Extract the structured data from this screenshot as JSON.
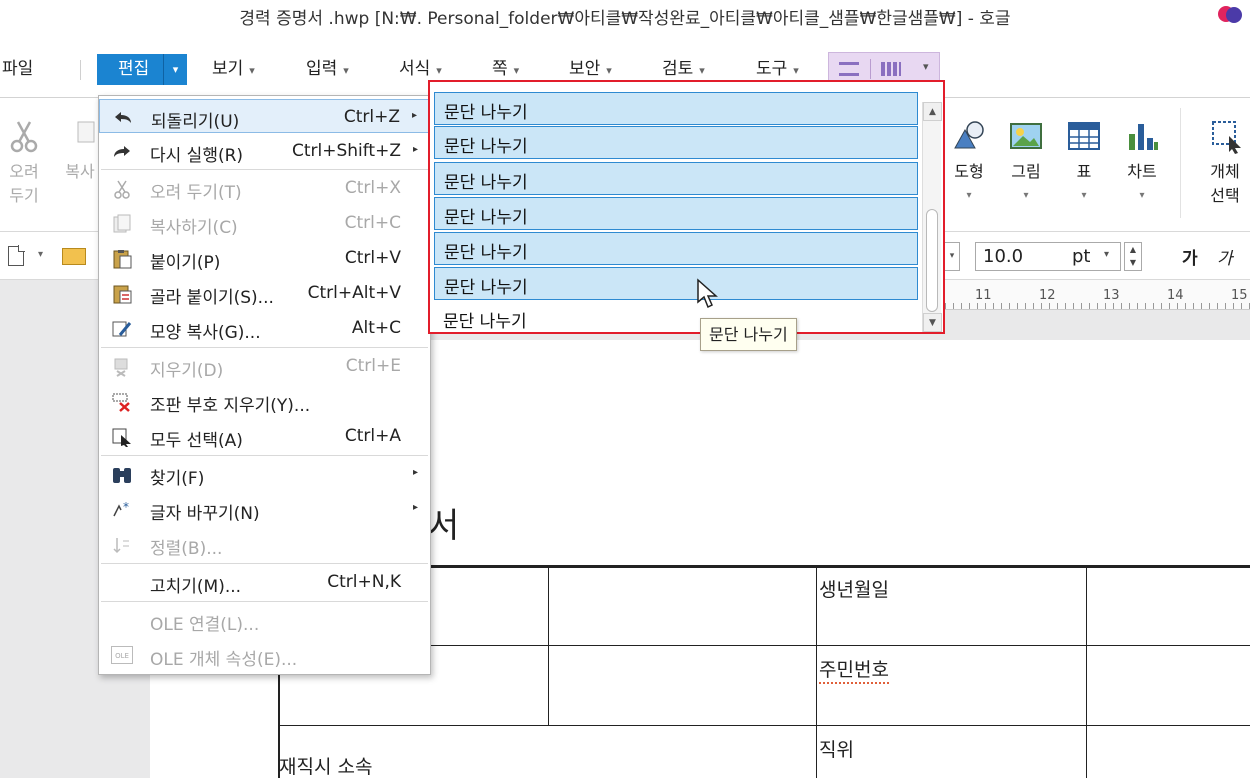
{
  "window": {
    "title": "경력 증명서 .hwp [N:₩. Personal_folder₩아티클₩작성완료_아티클₩아티클_샘플₩한글샘플₩] - 호글"
  },
  "menubar": {
    "file": "파일",
    "edit": "편집",
    "items": [
      {
        "label": "보기",
        "caret": "▾"
      },
      {
        "label": "입력",
        "caret": "▾"
      },
      {
        "label": "서식",
        "caret": "▾"
      },
      {
        "label": "쪽",
        "caret": "▾"
      },
      {
        "label": "보안",
        "caret": "▾"
      },
      {
        "label": "검토",
        "caret": "▾"
      },
      {
        "label": "도구",
        "caret": "▾"
      }
    ],
    "caret_glyph": "▾"
  },
  "ribbon": {
    "cut": {
      "label1": "오려",
      "label2": "두기"
    },
    "copy": {
      "label": "복사"
    },
    "shape": {
      "label": "도형"
    },
    "picture": {
      "label": "그림"
    },
    "table": {
      "label": "표"
    },
    "chart": {
      "label": "차트"
    },
    "object": {
      "label1": "개체",
      "label2": "선택"
    }
  },
  "toolbar2": {
    "font_size": "10.0",
    "unit": "pt",
    "bold": "가",
    "italic": "가"
  },
  "ruler": {
    "ticks": [
      "11",
      "12",
      "13",
      "14",
      "15"
    ]
  },
  "edit_menu": {
    "items": [
      {
        "label": "되돌리기(U)",
        "shortcut": "Ctrl+Z",
        "icon": "undo-icon"
      },
      {
        "label": "다시 실행(R)",
        "shortcut": "Ctrl+Shift+Z",
        "icon": "redo-icon"
      },
      {
        "label": "오려 두기(T)",
        "shortcut": "Ctrl+X",
        "icon": "cut-icon"
      },
      {
        "label": "복사하기(C)",
        "shortcut": "Ctrl+C",
        "icon": "copy-icon"
      },
      {
        "label": "붙이기(P)",
        "shortcut": "Ctrl+V",
        "icon": "paste-icon"
      },
      {
        "label": "골라 붙이기(S)...",
        "shortcut": "Ctrl+Alt+V",
        "icon": "paste-special-icon"
      },
      {
        "label": "모양 복사(G)...",
        "shortcut": "Alt+C",
        "icon": "format-painter-icon"
      },
      {
        "label": "지우기(D)",
        "shortcut": "Ctrl+E",
        "icon": "erase-icon"
      },
      {
        "label": "조판 부호 지우기(Y)...",
        "shortcut": "",
        "icon": "erase-codes-icon"
      },
      {
        "label": "모두 선택(A)",
        "shortcut": "Ctrl+A",
        "icon": "select-all-icon"
      },
      {
        "label": "찾기(F)",
        "shortcut": "",
        "icon": "binoculars-icon"
      },
      {
        "label": "글자 바꾸기(N)",
        "shortcut": "",
        "icon": "char-change-icon"
      },
      {
        "label": "정렬(B)...",
        "shortcut": "",
        "icon": "sort-icon"
      },
      {
        "label": "고치기(M)...",
        "shortcut": "Ctrl+N,K",
        "icon": ""
      },
      {
        "label": "OLE 연결(L)...",
        "shortcut": "",
        "icon": ""
      },
      {
        "label": "OLE 개체 속성(E)...",
        "shortcut": "",
        "icon": "ole-icon"
      }
    ],
    "ole_badge": "OLE",
    "submenu_arrow": "▸"
  },
  "undo_history": {
    "items": [
      "문단 나누기",
      "문단 나누기",
      "문단 나누기",
      "문단 나누기",
      "문단 나누기",
      "문단 나누기",
      "문단 나누기"
    ],
    "tooltip": "문단 나누기"
  },
  "document": {
    "title_fragment": "서",
    "cells": {
      "birth": "생년월일",
      "resident_no": "주민번호",
      "position": "직위",
      "affiliation": "재직시 소속"
    }
  },
  "colors": {
    "accent": "#1b84d1",
    "highlight_border": "#e21d2b",
    "selection": "#cbe6f7"
  }
}
